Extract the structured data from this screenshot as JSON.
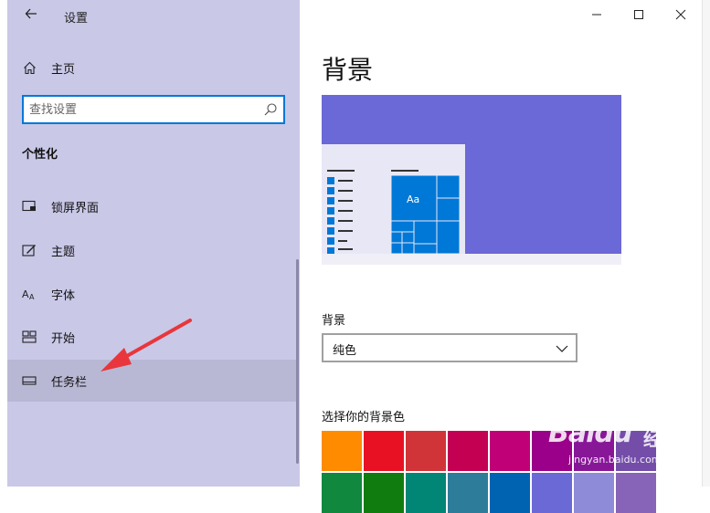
{
  "window": {
    "title": "设置",
    "back_icon": "back-arrow-icon",
    "controls": [
      "minimize-icon",
      "maximize-icon",
      "close-icon"
    ]
  },
  "sidebar": {
    "home_label": "主页",
    "search_placeholder": "查找设置",
    "section_title": "个性化",
    "items": [
      {
        "label": "锁屏界面",
        "icon": "lock-screen-icon",
        "selected": false
      },
      {
        "label": "主题",
        "icon": "theme-brush-icon",
        "selected": false
      },
      {
        "label": "字体",
        "icon": "font-icon",
        "selected": false
      },
      {
        "label": "开始",
        "icon": "start-menu-icon",
        "selected": false
      },
      {
        "label": "任务栏",
        "icon": "taskbar-icon",
        "selected": true
      }
    ],
    "background_color": "#c9c8e7"
  },
  "main": {
    "page_title": "背景",
    "preview": {
      "background_color": "#6b68d7",
      "tile_color": "#0078d7",
      "tile_text": "Aa"
    },
    "background_label": "背景",
    "background_value": "纯色",
    "colors_label": "选择你的背景色",
    "swatch_colors_row1": [
      "#ff8c00",
      "#e81123",
      "#d13438",
      "#c30052",
      "#bf0077",
      "#9a0089",
      "#881798",
      "#744da9"
    ],
    "swatch_colors_row2": [
      "#10893e",
      "#107c10",
      "#018574",
      "#2d7d9a",
      "#0063b1",
      "#6b69d6",
      "#8e8cd8",
      "#8764b8"
    ]
  },
  "watermark": {
    "logo": "Baidu",
    "logo_cn": "经验",
    "url": "jingyan.baidu.com"
  }
}
